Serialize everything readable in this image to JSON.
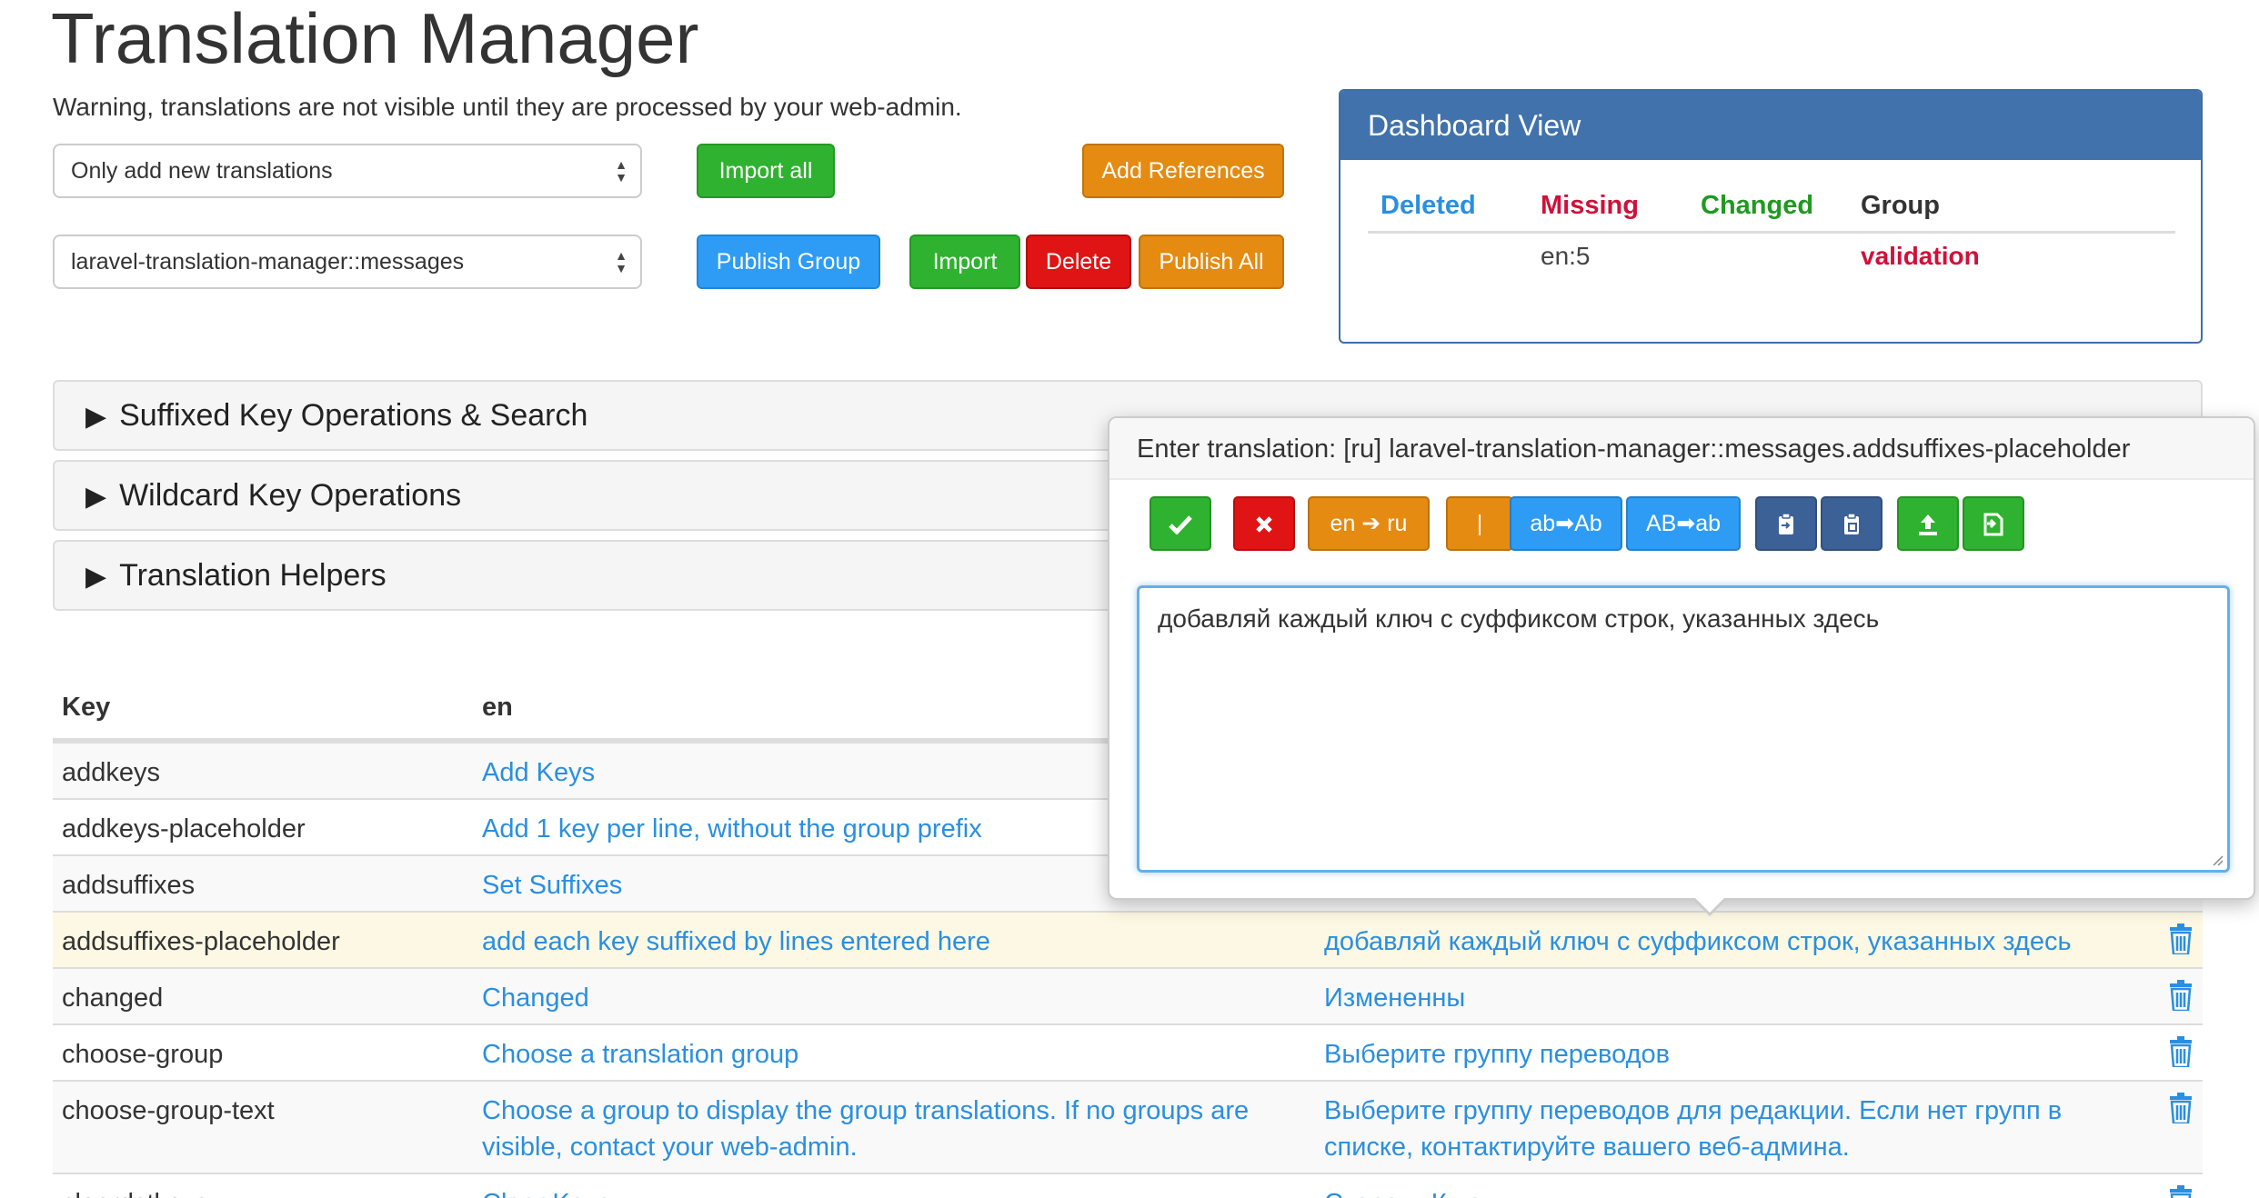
{
  "page": {
    "title": "Translation Manager",
    "warning": "Warning, translations are not visible until they are processed by your web-admin."
  },
  "controls": {
    "import_mode_select": "Only add new translations",
    "group_select": "laravel-translation-manager::messages",
    "import_all": "Import all",
    "add_references": "Add References",
    "publish_group": "Publish Group",
    "import": "Import",
    "delete": "Delete",
    "publish_all": "Publish All"
  },
  "dashboard": {
    "title": "Dashboard View",
    "headers": {
      "deleted": "Deleted",
      "missing": "Missing",
      "changed": "Changed",
      "group": "Group"
    },
    "row": {
      "missing": "en:5",
      "group": "validation"
    },
    "colors": {
      "deleted": "#2a8fe0",
      "missing": "#d0103a",
      "changed": "#1f9a1f",
      "group_link": "#d0103a"
    }
  },
  "sections": [
    {
      "label": "Suffixed Key Operations & Search"
    },
    {
      "label": "Wildcard Key Operations"
    },
    {
      "label": "Translation Helpers"
    }
  ],
  "table": {
    "headers": {
      "key": "Key",
      "en": "en"
    },
    "rows": [
      {
        "key": "addkeys",
        "en": "Add Keys",
        "ru": ""
      },
      {
        "key": "addkeys-placeholder",
        "en": "Add 1 key per line, without the group prefix",
        "ru": ""
      },
      {
        "key": "addsuffixes",
        "en": "Set Suffixes",
        "ru": ""
      },
      {
        "key": "addsuffixes-placeholder",
        "en": "add each key suffixed by lines entered here",
        "ru": "добавляй каждый ключ с суффиксом строк, указанных здесь"
      },
      {
        "key": "changed",
        "en": "Changed",
        "ru": "Измененны"
      },
      {
        "key": "choose-group",
        "en": "Choose a translation group",
        "ru": "Выберите группу переводов"
      },
      {
        "key": "choose-group-text",
        "en": "Choose a group to display the group translations. If no groups are visible, contact your web-admin.",
        "ru": "Выберите группу переводов для редакции. Если нет групп в списке, контактируйте вашего веб-админа."
      },
      {
        "key": "cleardstkeys",
        "en": "Clear Keys",
        "ru": "Стереть Ключи"
      }
    ]
  },
  "popover": {
    "title": "Enter translation: [ru] laravel-translation-manager::messages.addsuffixes-placeholder",
    "buttons": {
      "translate": "en ➔ ru",
      "pipe": "|",
      "capitalize": "ab➡Ab",
      "lowercase": "AB➡ab"
    },
    "textarea_value": "добавляй каждый ключ с суффиксом строк, указанных здесь"
  },
  "icons": {
    "ok": "check-icon",
    "cancel": "x-icon",
    "copy": "clipboard-copy-icon",
    "paste": "clipboard-paste-icon",
    "upload": "upload-icon",
    "save": "save-icon",
    "delete": "trash-icon"
  }
}
